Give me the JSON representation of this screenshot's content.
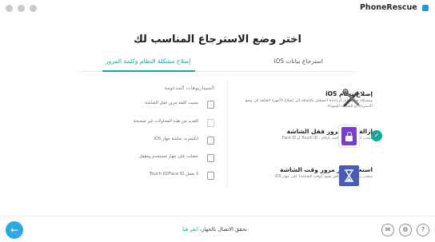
{
  "app": {
    "brand": "PhoneRescue"
  },
  "main": {
    "title": "اختر وضع الاسترجاع المناسب لك",
    "tabs": [
      {
        "label": "استرجاع بيانات iOS",
        "active": false
      },
      {
        "label": "إصلاح مشكلة النظام وكلمة المرور",
        "active": true
      }
    ]
  },
  "options": [
    {
      "title": "إصلاح نظام iOS",
      "desc": "ومشكلة شاشة أبل أو إعادة التشغيل بالإضافة إلى إصلاح الأجهزة العالقة في وضع الاسترداد أو الشاشة السوداء",
      "icon": "tools-icon"
    },
    {
      "title": "إزالة كلمة مرور قفل الشاشة",
      "desc": "سحب كلمة مرور الشاشة، أرقام ، Touch ID أو Face ID",
      "icon": "lock-icon"
    },
    {
      "title": "استعادة رمز مرور وقت الشاشة",
      "desc": "سحب رمز المرور الخاص بقيود (وقت الشاشة) على جهاز iOS",
      "icon": "hourglass-icon"
    }
  ],
  "scenarios": {
    "title": "السيناريوهات المدعومة",
    "items": [
      "نسيت كلمة مرور قفل الشاشة",
      "العديد من هذه المحاولات غير صحيحة",
      "انكسرت شاشة جهاز iOS",
      "حصلت على جهاز مستخدم ومقفل",
      "لا يعمل Touch ID/Face ID"
    ]
  },
  "footer": {
    "status_text": "تحقق الاتصال بالجهاز،",
    "status_link": "انقر هنا",
    "buttons": [
      "mail-icon",
      "settings-icon",
      "help-icon"
    ]
  },
  "colors": {
    "accent": "#15a89a",
    "back_button": "#2ea8e3",
    "lock_tile": "#7b3bd6",
    "hourglass_tile": "#4a5bb8"
  }
}
